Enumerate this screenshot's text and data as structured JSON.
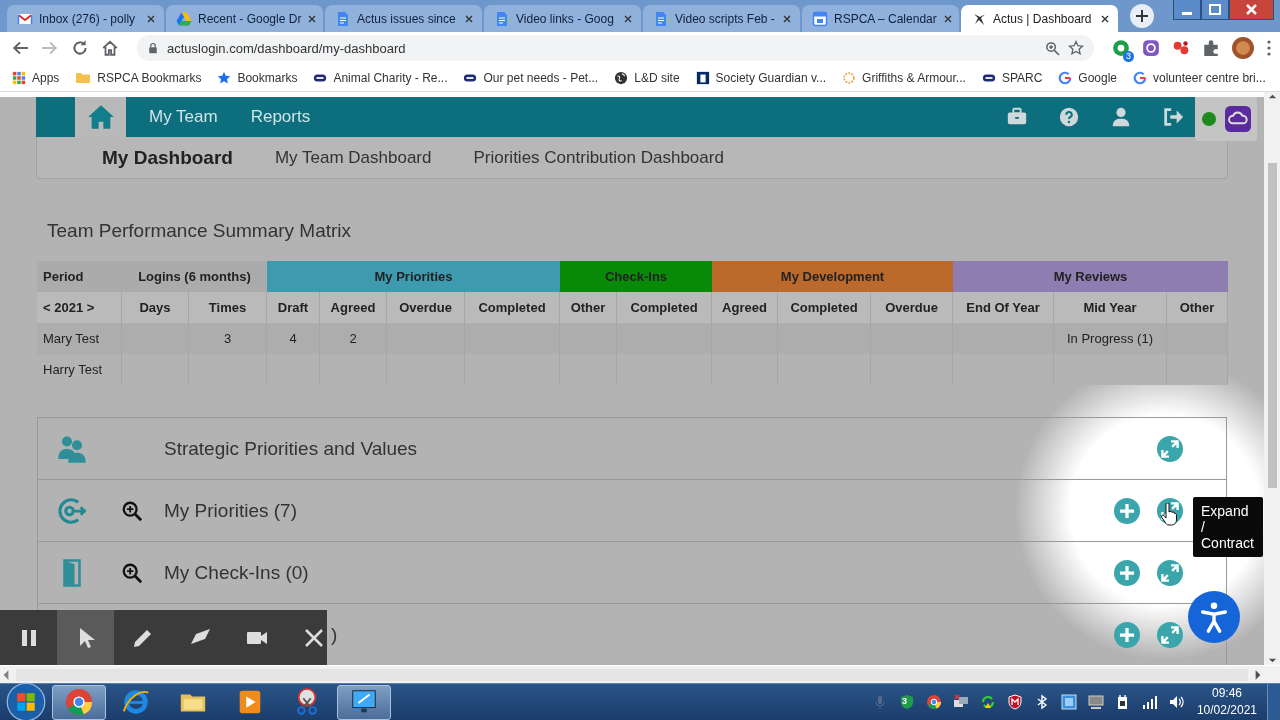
{
  "browser": {
    "tabs": [
      {
        "title": "Inbox (276) - polly",
        "kind": "mail",
        "selected": false
      },
      {
        "title": "Recent - Google Dr",
        "kind": "drive",
        "selected": false
      },
      {
        "title": "Actus issues since",
        "kind": "doc",
        "selected": false
      },
      {
        "title": "Video links - Goog",
        "kind": "doc",
        "selected": false
      },
      {
        "title": "Video scripts Feb -",
        "kind": "doc",
        "selected": false
      },
      {
        "title": "RSPCA – Calendar",
        "kind": "calendar",
        "selected": false
      },
      {
        "title": "Actus | Dashboard",
        "kind": "app",
        "selected": true
      }
    ],
    "url": "actuslogin.com/dashboard/my-dashboard",
    "extension_badge": "3",
    "bookmarks": [
      {
        "label": "Apps",
        "kind": "grid"
      },
      {
        "label": "RSPCA Bookmarks",
        "kind": "folder"
      },
      {
        "label": "Bookmarks",
        "kind": "star"
      },
      {
        "label": "Animal Charity - Re...",
        "kind": "badge"
      },
      {
        "label": "Our pet needs - Pet...",
        "kind": "badge"
      },
      {
        "label": "L&D site",
        "kind": "globe"
      },
      {
        "label": "Society Guardian v...",
        "kind": "square"
      },
      {
        "label": "Griffiths & Armour...",
        "kind": "ring"
      },
      {
        "label": "SPARC",
        "kind": "badge"
      },
      {
        "label": "Google",
        "kind": "g"
      },
      {
        "label": "volunteer centre bri...",
        "kind": "g"
      }
    ]
  },
  "app": {
    "nav": [
      {
        "kind": "home",
        "selected": true
      },
      {
        "kind": "link",
        "label": "My Team",
        "selected": false
      },
      {
        "kind": "link",
        "label": "Reports",
        "selected": false
      }
    ],
    "subnav": [
      {
        "label": "My Dashboard",
        "selected": true
      },
      {
        "label": "My Team Dashboard",
        "selected": false
      },
      {
        "label": "Priorities Contribution Dashboard",
        "selected": false
      }
    ],
    "matrix": {
      "title": "Team Performance Summary Matrix",
      "groups": [
        {
          "label": "Period",
          "columns": [
            "< 2021 >"
          ]
        },
        {
          "label": "Logins (6 months)",
          "columns": [
            "Days",
            "Times"
          ]
        },
        {
          "label": "My Priorities",
          "color": "#3e9aae",
          "columns": [
            "Draft",
            "Agreed",
            "Overdue",
            "Completed"
          ]
        },
        {
          "label": "Check-Ins",
          "color": "#088a08",
          "columns": [
            "Other",
            "Completed"
          ]
        },
        {
          "label": "My Development",
          "color": "#bb6a2b",
          "columns": [
            "Agreed",
            "Completed",
            "Overdue"
          ]
        },
        {
          "label": "My Reviews",
          "color": "#8d7db0",
          "columns": [
            "End Of Year",
            "Mid Year",
            "Other"
          ]
        }
      ],
      "rows": [
        {
          "cells": [
            "Mary Test",
            null,
            "3",
            "4",
            "2",
            null,
            null,
            null,
            null,
            null,
            null,
            null,
            null,
            "In Progress (1)",
            null
          ]
        },
        {
          "cells": [
            "Harry Test",
            null,
            null,
            null,
            null,
            null,
            null,
            null,
            null,
            null,
            null,
            null,
            null,
            null,
            null
          ]
        }
      ]
    },
    "panels": [
      {
        "kind": "values",
        "title": "Strategic Priorities and Values"
      },
      {
        "kind": "priorities",
        "title": "My Priorities (7)"
      },
      {
        "kind": "checkins",
        "title": "My Check-Ins (0)"
      },
      {
        "kind": "covered",
        "title": ")"
      }
    ],
    "tooltip": "Expand / Contract",
    "recorder": [
      {
        "kind": "pause",
        "selected": false
      },
      {
        "kind": "pointer",
        "selected": true
      },
      {
        "kind": "pen",
        "selected": false
      },
      {
        "kind": "eraser",
        "selected": false
      },
      {
        "kind": "camera",
        "selected": false
      },
      {
        "kind": "close",
        "selected": false
      }
    ]
  },
  "taskbar": {
    "apps": [
      {
        "kind": "chrome",
        "selected": true
      },
      {
        "kind": "ie",
        "selected": false
      },
      {
        "kind": "folder",
        "selected": false
      },
      {
        "kind": "media",
        "selected": false
      },
      {
        "kind": "snip",
        "selected": false
      },
      {
        "kind": "monitor",
        "selected": true
      }
    ],
    "tray_badge": "3",
    "time": "09:46",
    "date": "10/02/2021"
  }
}
